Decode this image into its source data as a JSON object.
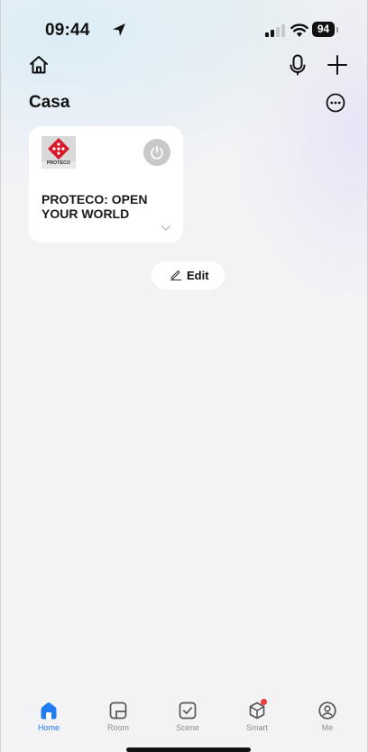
{
  "status_bar": {
    "time": "09:44",
    "battery": "94"
  },
  "header": {
    "title": "Casa",
    "icons": [
      "home-icon",
      "microphone-icon",
      "plus-icon",
      "more-icon"
    ]
  },
  "device_card": {
    "logo_text": "PROTECO",
    "name": "PROTECO: OPEN YOUR WORLD",
    "power_state": "off"
  },
  "edit_button": {
    "label": "Edit"
  },
  "tabbar": {
    "tabs": [
      {
        "label": "Home",
        "icon": "home-tab-icon",
        "active": true
      },
      {
        "label": "Room",
        "icon": "room-icon",
        "active": false
      },
      {
        "label": "Scene",
        "icon": "scene-icon",
        "active": false
      },
      {
        "label": "Smart",
        "icon": "smart-icon",
        "active": false
      },
      {
        "label": "Me",
        "icon": "me-icon",
        "active": false
      }
    ]
  },
  "colors": {
    "accent": "#1f7cf2",
    "logo_red": "#d7182a",
    "notification_dot": "#ef3b3b",
    "inactive_tab": "#8c8c8c"
  }
}
